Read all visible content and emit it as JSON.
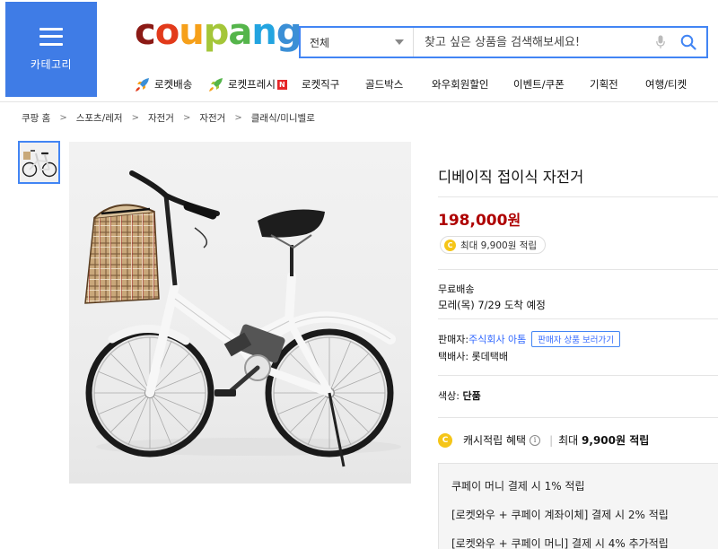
{
  "header": {
    "category_label": "카테고리",
    "logo_letters": [
      {
        "ch": "c",
        "color": "#8b1a15"
      },
      {
        "ch": "o",
        "color": "#e23a1b"
      },
      {
        "ch": "u",
        "color": "#f6a01a"
      },
      {
        "ch": "p",
        "color": "#a4c639"
      },
      {
        "ch": "a",
        "color": "#55b54b"
      },
      {
        "ch": "n",
        "color": "#23a4e0"
      },
      {
        "ch": "g",
        "color": "#3b8fd6"
      }
    ],
    "search": {
      "category": "전체",
      "placeholder": "찾고 싶은 상품을 검색해보세요!"
    },
    "nav": [
      {
        "label": "로켓배송",
        "icon": "rocket-icon",
        "width": 82
      },
      {
        "label": "로켓프레시",
        "icon": "rocket-icon",
        "badge": "N",
        "width": 104
      },
      {
        "label": "로켓직구",
        "width": 71
      },
      {
        "label": "골드박스",
        "width": 74
      },
      {
        "label": "와우회원할인",
        "width": 91
      },
      {
        "label": "이벤트/쿠폰",
        "width": 85
      },
      {
        "label": "기획전",
        "width": 62
      },
      {
        "label": "여행/티켓",
        "width": 70
      }
    ]
  },
  "breadcrumb": [
    "쿠팡 홈",
    "스포츠/레저",
    "자전거",
    "자전거",
    "클래식/미니벨로"
  ],
  "product": {
    "title": "디베이직 접이식 자전거",
    "price": "198,000",
    "currency": "원",
    "coin_glyph": "C",
    "reward": "최대 9,900원 적립",
    "shipping_title": "무료배송",
    "delivery_date": "모레(목) 7/29 도착 예정",
    "seller_label": "판매자:",
    "seller_name": "주식회사 아톰",
    "seller_button": "판매자 상품 보러가기",
    "courier": "택배사: 롯데택배",
    "option_label": "색상:",
    "option_value": "단품",
    "cash_label": "캐시적립 혜택",
    "cash_info": "i",
    "cash_sep": "|",
    "cash_max_prefix": "최대",
    "cash_max_value": "9,900원 적립",
    "benefits": [
      "쿠페이 머니 결제 시 1% 적립",
      "[로켓와우 + 쿠페이 계좌이체] 결제 시 2% 적립",
      "[로켓와우 + 쿠페이 머니] 결제 시 4% 추가적립"
    ]
  },
  "colors": {
    "accent": "#4285f4",
    "category_bg": "#3f7ce6",
    "price": "#ae0000",
    "link": "#346aff"
  }
}
